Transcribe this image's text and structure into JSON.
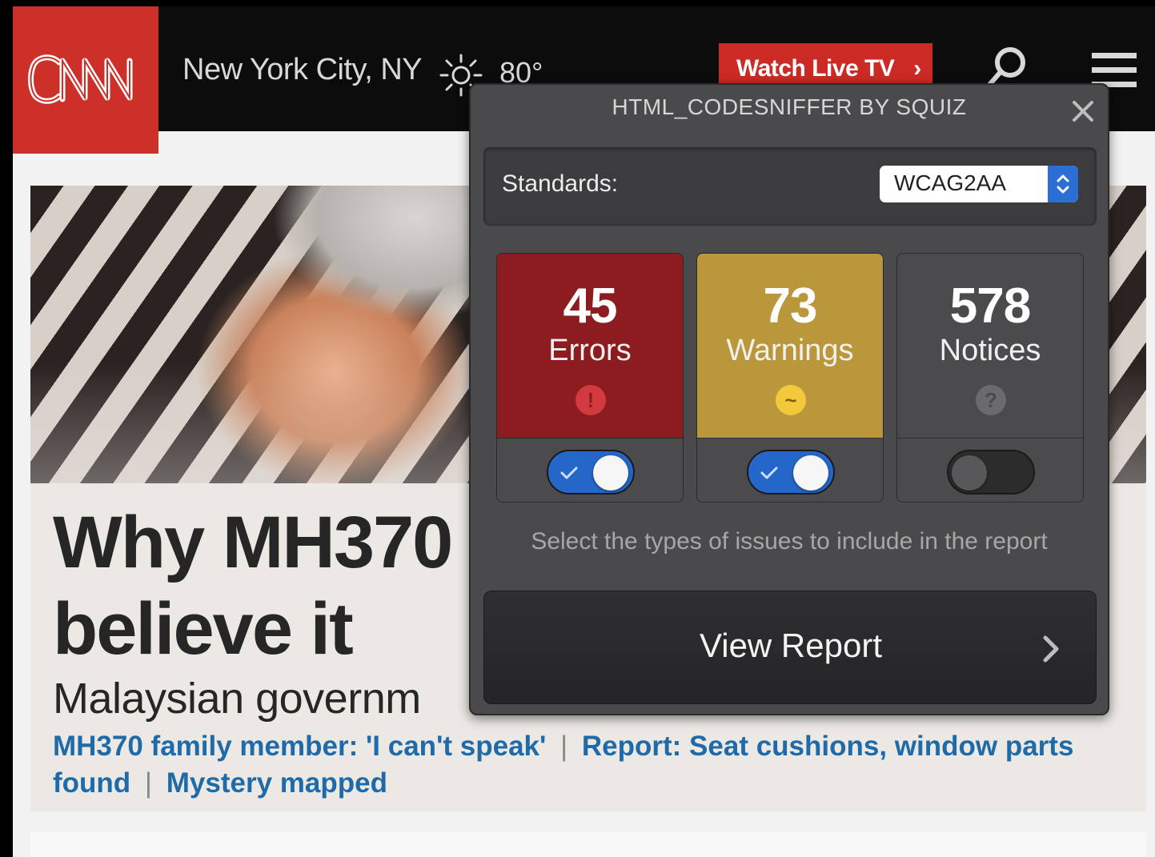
{
  "header": {
    "logo_text": "CNN",
    "location": "New York City, NY",
    "weather_icon": "sun-icon",
    "temperature": "80°",
    "watch_live_label": "Watch Live TV",
    "watch_live_chevron": "›",
    "search_icon": "search-icon",
    "menu_icon": "menu-icon"
  },
  "hero": {
    "headline": "Why MH370",
    "headline_line2": "believe it",
    "subhead": "Malaysian governm",
    "related_links": [
      "MH370 family member: 'I can't speak'",
      "Report: Seat cushions, window parts found",
      "Mystery mapped"
    ],
    "separator": "|"
  },
  "codesniffer": {
    "title": "HTML_CODESNIFFER BY SQUIZ",
    "close_icon": "close-icon",
    "standards_label": "Standards:",
    "standards_value": "WCAG2AA",
    "cards": [
      {
        "count": "45",
        "label": "Errors",
        "icon": "!",
        "icon_name": "error-icon",
        "color": "#8c1c1f",
        "icon_bg": "#d33a3f",
        "icon_fg": "#8c1c1f",
        "enabled": true
      },
      {
        "count": "73",
        "label": "Warnings",
        "icon": "~",
        "icon_name": "warning-icon",
        "color": "#b9973a",
        "icon_bg": "#f1c93a",
        "icon_fg": "#7a5f16",
        "enabled": true
      },
      {
        "count": "578",
        "label": "Notices",
        "icon": "?",
        "icon_name": "notice-icon",
        "color": "#4b4b4d",
        "icon_bg": "#6b6b6d",
        "icon_fg": "#4b4b4d",
        "enabled": false
      }
    ],
    "hint": "Select the types of issues to include in the report",
    "view_report_label": "View Report"
  },
  "colors": {
    "cnn_red": "#cc3029",
    "link_blue": "#1f6aa8",
    "toggle_on": "#2566c9"
  }
}
